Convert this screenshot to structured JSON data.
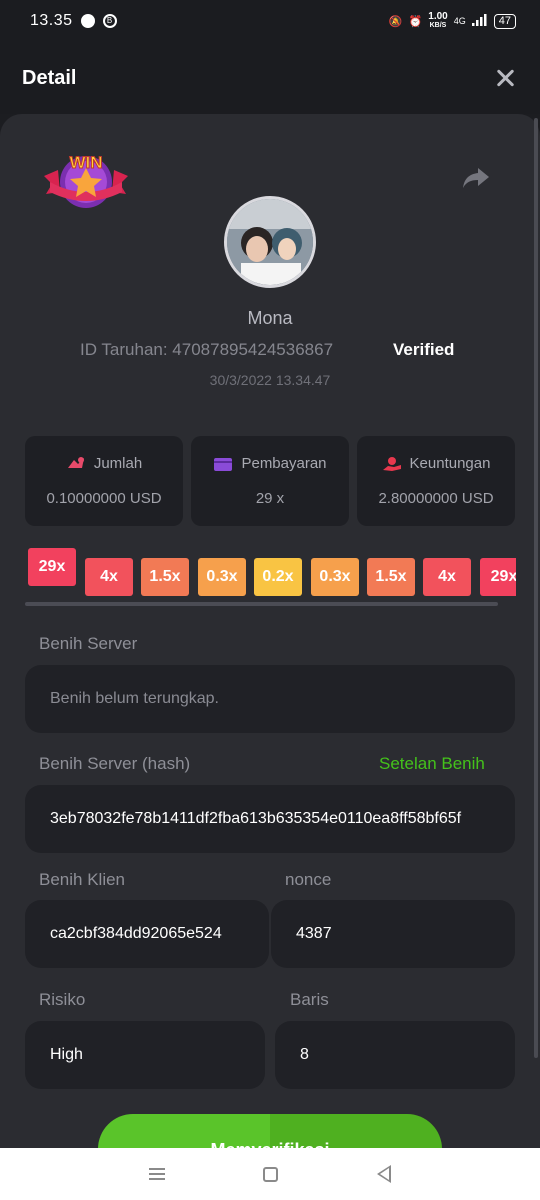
{
  "status_bar": {
    "time": "13.35",
    "net_speed_value": "1.00",
    "net_speed_unit": "KB/S",
    "network": "4G",
    "battery": "47"
  },
  "header": {
    "title": "Detail"
  },
  "profile": {
    "win_badge_text": "WIN",
    "username": "Mona",
    "bet_id": "ID Taruhan: 4708789542453686​7",
    "verified": "Verified",
    "date": "30/3/2022 13.34.47"
  },
  "stats": [
    {
      "label": "Jumlah",
      "value": "0.10000000 USD",
      "icon": "coins-icon"
    },
    {
      "label": "Pembayaran",
      "value": "29 x",
      "icon": "wallet-icon"
    },
    {
      "label": "Keuntungan",
      "value": "2.80000000 USD",
      "icon": "profit-hand-icon"
    }
  ],
  "multipliers": [
    {
      "label": "29x",
      "color": "#f2415e",
      "active": true
    },
    {
      "label": "4x",
      "color": "#f2525c"
    },
    {
      "label": "1.5x",
      "color": "#f27a55"
    },
    {
      "label": "0.3x",
      "color": "#f6a04c"
    },
    {
      "label": "0.2x",
      "color": "#f9c443"
    },
    {
      "label": "0.3x",
      "color": "#f6a04c"
    },
    {
      "label": "1.5x",
      "color": "#f27a55"
    },
    {
      "label": "4x",
      "color": "#f2525c"
    },
    {
      "label": "29x",
      "color": "#f2415e"
    }
  ],
  "server_seed": {
    "label": "Benih Server",
    "placeholder": "Benih belum terungkap."
  },
  "server_seed_hash": {
    "label": "Benih Server (hash)",
    "link": "Setelan Benih",
    "value": "3eb78032fe78b1411df2fba613b635354e0110ea8ff58bf65f"
  },
  "client_seed": {
    "label": "Benih Klien",
    "value": "ca2cbf384dd92065e524"
  },
  "nonce": {
    "label": "nonce",
    "value": "4387"
  },
  "risk": {
    "label": "Risiko",
    "value": "High"
  },
  "rows": {
    "label": "Baris",
    "value": "8"
  },
  "verify_button": "Memverifikasi",
  "colors": {
    "background": "#1c1d21",
    "sheet": "#2b2c31",
    "accent_green": "#44c21b",
    "button_green": "#5ac42a"
  }
}
